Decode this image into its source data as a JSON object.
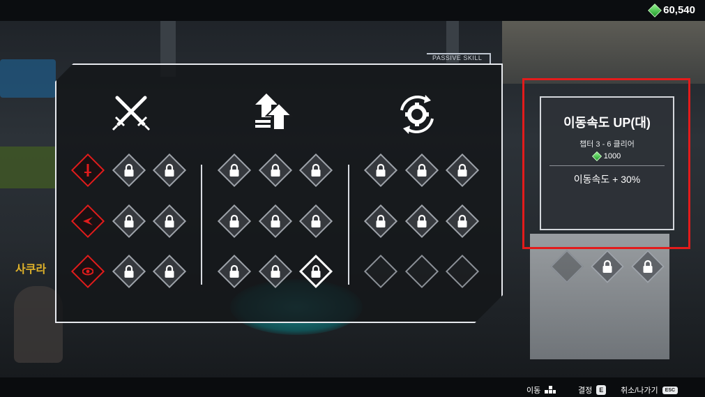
{
  "currency": {
    "icon": "green-gem-icon",
    "amount": "60,540"
  },
  "panel": {
    "tab_label": "PASSIVE SKILL"
  },
  "background": {
    "sign_text": "사쿠라"
  },
  "categories": [
    {
      "icon": "crossed-swords-icon"
    },
    {
      "icon": "double-up-arrows-icon"
    },
    {
      "icon": "cycle-gear-icon"
    }
  ],
  "skill_grid": {
    "group1": [
      [
        "sword-icon",
        "lock-icon",
        "lock-icon"
      ],
      [
        "dash-icon",
        "lock-icon",
        "lock-icon"
      ],
      [
        "eye-icon",
        "lock-icon",
        "lock-icon"
      ]
    ],
    "group2": [
      [
        "lock-icon",
        "lock-icon",
        "lock-icon"
      ],
      [
        "lock-icon",
        "lock-icon",
        "lock-icon"
      ],
      [
        "lock-icon",
        "lock-icon",
        "lock-icon-selected"
      ]
    ],
    "group3": [
      [
        "lock-icon",
        "lock-icon",
        "lock-icon"
      ],
      [
        "lock-icon",
        "lock-icon",
        "lock-icon"
      ],
      [
        "empty",
        "empty",
        "empty"
      ]
    ],
    "extra_row": [
      "empty",
      "lock-icon",
      "lock-icon"
    ]
  },
  "detail": {
    "title": "이동속도 UP(대)",
    "requirement": "챕터 3 - 6 클리어",
    "cost": "1000",
    "effect": "이동속도 + 30%"
  },
  "footer": {
    "move_label": "이동",
    "confirm_label": "결정",
    "confirm_key": "E",
    "cancel_label": "취소/나가기",
    "cancel_key": "ESC"
  },
  "colors": {
    "accent_red": "#e11c1c",
    "gem_green": "#3fcf3f"
  }
}
